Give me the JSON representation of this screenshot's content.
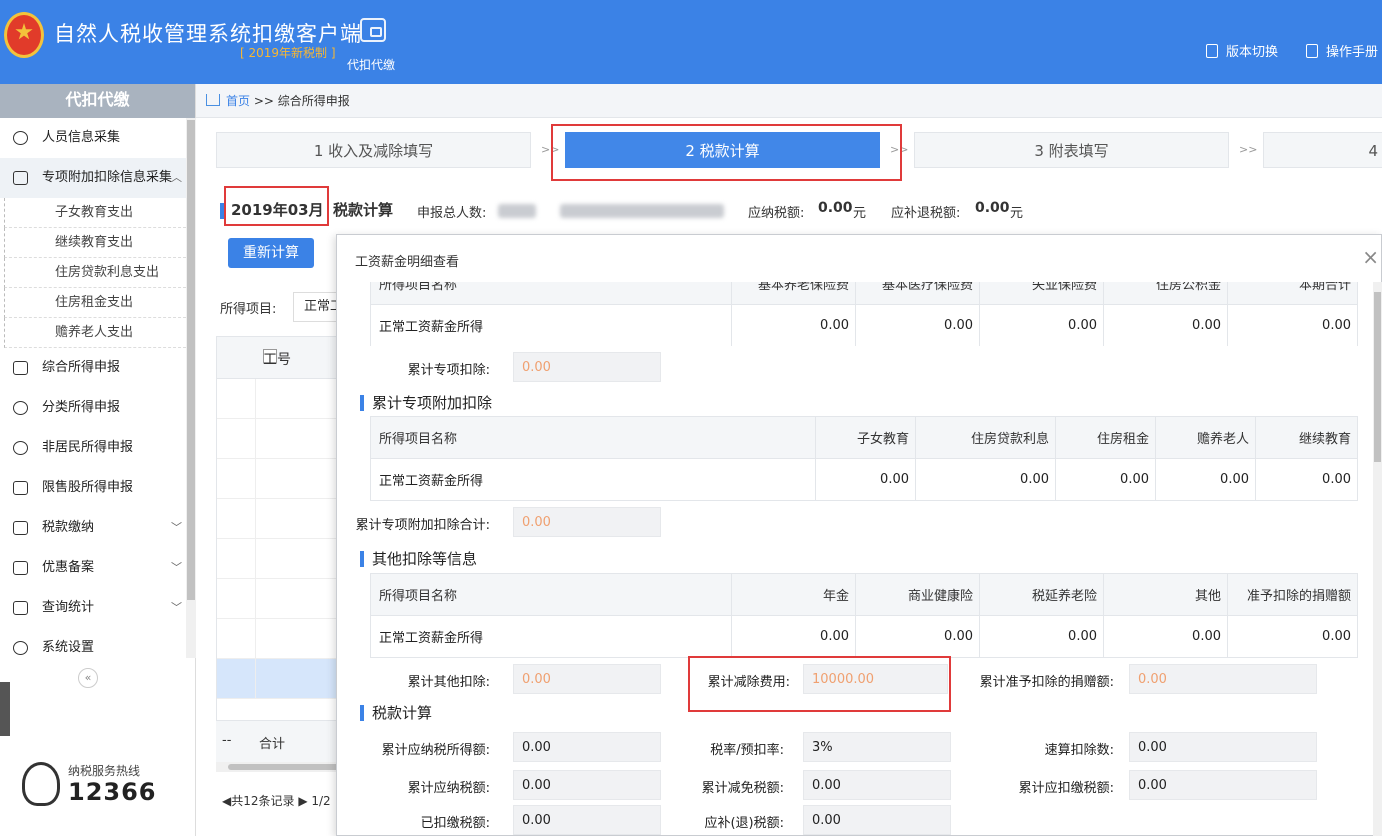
{
  "header": {
    "title": "自然人税收管理系统扣缴客户端",
    "subtitle": "[ 2019年新税制 ]",
    "tool_label": "代扣代缴",
    "version_switch": "版本切换",
    "manual": "操作手册"
  },
  "sidebar": {
    "title": "代扣代缴",
    "items": [
      {
        "label": "人员信息采集"
      },
      {
        "label": "专项附加扣除信息采集",
        "sub": [
          "子女教育支出",
          "继续教育支出",
          "住房贷款利息支出",
          "住房租金支出",
          "赡养老人支出"
        ]
      },
      {
        "label": "综合所得申报"
      },
      {
        "label": "分类所得申报"
      },
      {
        "label": "非居民所得申报"
      },
      {
        "label": "限售股所得申报"
      },
      {
        "label": "税款缴纳"
      },
      {
        "label": "优惠备案"
      },
      {
        "label": "查询统计"
      },
      {
        "label": "系统设置"
      }
    ],
    "collapse": "«",
    "hotline_label": "纳税服务热线",
    "hotline_number": "12366"
  },
  "breadcrumb": {
    "home": "首页",
    "sep": ">>",
    "current": "综合所得申报"
  },
  "steps": [
    "1 收入及减除填写",
    "2 税款计算",
    "3 附表填写",
    "4"
  ],
  "step_sep": ">>",
  "summary": {
    "period": "2019年03月",
    "title": "税款计算",
    "count_label": "申报总人数:",
    "tax_label": "应纳税额:",
    "tax_value": "0.00",
    "unit": "元",
    "refund_label": "应补退税额:",
    "refund_value": "0.00",
    "refund_unit": "元"
  },
  "recalc_button": "重新计算",
  "filter": {
    "label": "所得项目:",
    "value": "正常工"
  },
  "bg_table": {
    "header": "工号",
    "total_dash": "--",
    "total_label": "合计",
    "pager": "共12条记录",
    "page": "1/2"
  },
  "modal": {
    "title": "工资薪金明细查看",
    "close": "×",
    "table1": {
      "headers": [
        "所得项目名称",
        "基本养老保险费",
        "基本医疗保险费",
        "失业保险费",
        "住房公积金",
        "本期合计"
      ],
      "row": [
        "正常工资薪金所得",
        "0.00",
        "0.00",
        "0.00",
        "0.00",
        "0.00"
      ]
    },
    "special_total_label": "累计专项扣除:",
    "special_total_value": "0.00",
    "section2": "累计专项附加扣除",
    "table2": {
      "headers": [
        "所得项目名称",
        "子女教育",
        "住房贷款利息",
        "住房租金",
        "赡养老人",
        "继续教育"
      ],
      "row": [
        "正常工资薪金所得",
        "0.00",
        "0.00",
        "0.00",
        "0.00",
        "0.00"
      ]
    },
    "add_total_label": "累计专项附加扣除合计:",
    "add_total_value": "0.00",
    "section3": "其他扣除等信息",
    "table3": {
      "headers": [
        "所得项目名称",
        "年金",
        "商业健康险",
        "税延养老险",
        "其他",
        "准予扣除的捐赠额"
      ],
      "row": [
        "正常工资薪金所得",
        "0.00",
        "0.00",
        "0.00",
        "0.00",
        "0.00"
      ]
    },
    "other_label": "累计其他扣除:",
    "other_value": "0.00",
    "deduct_label": "累计减除费用:",
    "deduct_value": "10000.00",
    "donation_label": "累计准予扣除的捐赠额:",
    "donation_value": "0.00",
    "section4": "税款计算",
    "calc": [
      {
        "label": "累计应纳税所得额:",
        "value": "0.00"
      },
      {
        "label": "税率/预扣率:",
        "value": "3%"
      },
      {
        "label": "速算扣除数:",
        "value": "0.00"
      },
      {
        "label": "累计应纳税额:",
        "value": "0.00"
      },
      {
        "label": "累计减免税额:",
        "value": "0.00"
      },
      {
        "label": "累计应扣缴税额:",
        "value": "0.00"
      },
      {
        "label": "已扣缴税额:",
        "value": "0.00"
      },
      {
        "label": "应补(退)税额:",
        "value": "0.00"
      }
    ]
  }
}
